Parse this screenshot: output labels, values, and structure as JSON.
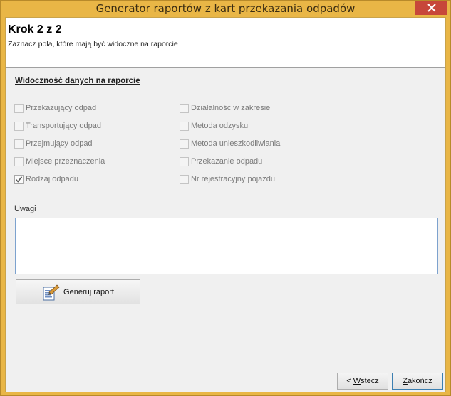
{
  "window": {
    "title": "Generator raportów z kart przekazania odpadów"
  },
  "header": {
    "step": "Krok 2 z 2",
    "subtitle": "Zaznacz pola, które mają być widoczne na raporcie"
  },
  "visibility": {
    "title": "Widoczność danych na raporcie",
    "left": [
      {
        "label": "Przekazujący odpad",
        "checked": false
      },
      {
        "label": "Transportujący odpad",
        "checked": false
      },
      {
        "label": "Przejmujący odpad",
        "checked": false
      },
      {
        "label": "Miejsce przeznaczenia",
        "checked": false
      },
      {
        "label": "Rodzaj odpadu",
        "checked": true
      }
    ],
    "right": [
      {
        "label": "Działalność w zakresie",
        "checked": false
      },
      {
        "label": "Metoda odzysku",
        "checked": false
      },
      {
        "label": "Metoda unieszkodliwiania",
        "checked": false
      },
      {
        "label": "Przekazanie odpadu",
        "checked": false
      },
      {
        "label": "Nr rejestracyjny pojazdu",
        "checked": false
      }
    ]
  },
  "notes": {
    "label": "Uwagi",
    "value": ""
  },
  "generate": {
    "label": "Generuj raport"
  },
  "footer": {
    "back_prefix": "< ",
    "back_key": "W",
    "back_rest": "stecz",
    "finish_key": "Z",
    "finish_rest": "akończ"
  },
  "colors": {
    "titlebar": "#e9b646",
    "close": "#c7473a",
    "accent_border": "#7da2ce"
  }
}
